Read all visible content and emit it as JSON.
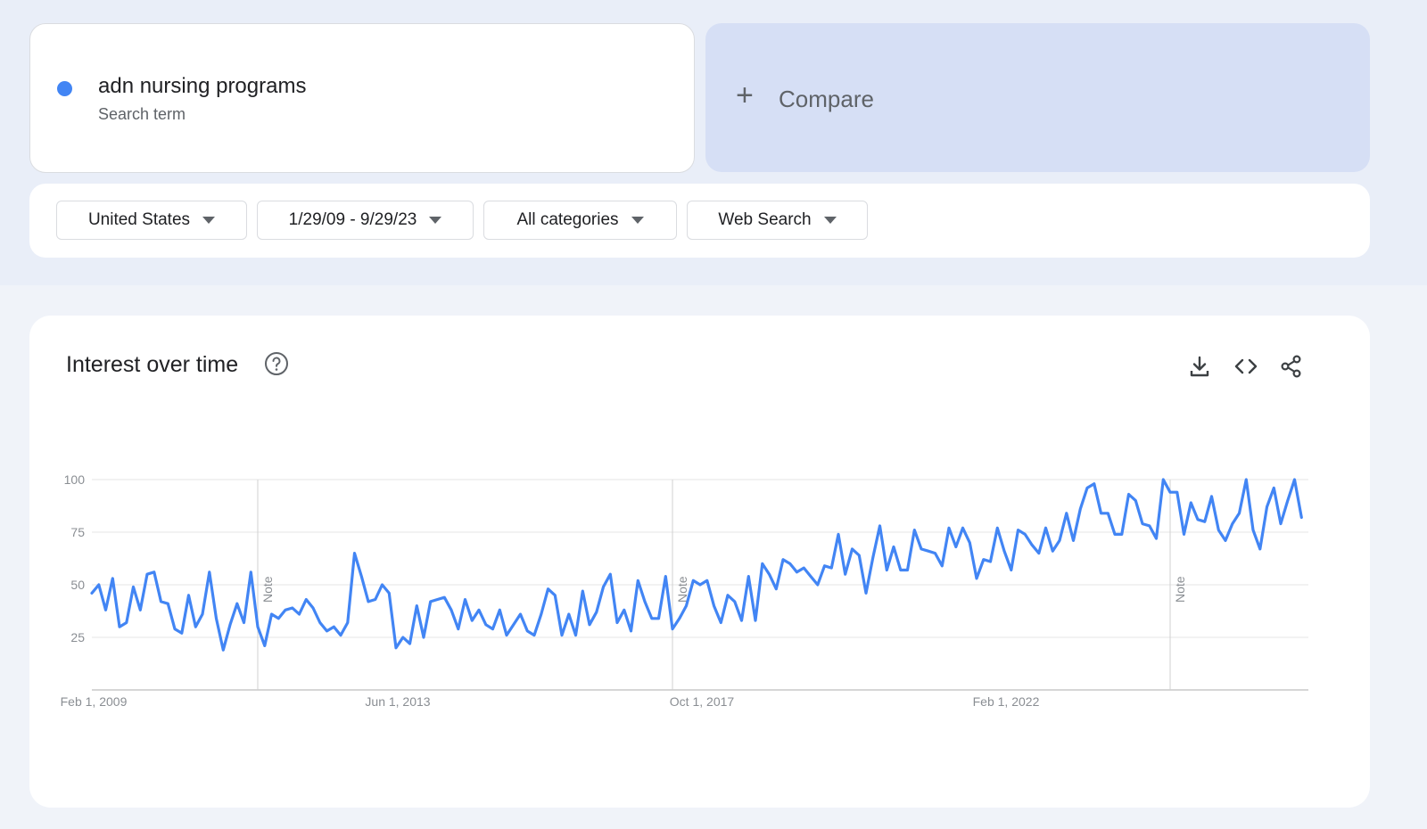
{
  "search_term": {
    "name": "adn nursing programs",
    "subtitle": "Search term",
    "color": "#4285f4"
  },
  "compare": {
    "plus": "+",
    "label": "Compare"
  },
  "filters": {
    "region": "United States",
    "date_range": "1/29/09 - 9/29/23",
    "category": "All categories",
    "search_type": "Web Search"
  },
  "panel": {
    "title": "Interest over time",
    "icons": [
      "help-icon",
      "download-icon",
      "embed-icon",
      "share-icon"
    ]
  },
  "chart_data": {
    "type": "line",
    "title": "Interest over time",
    "xlabel": "",
    "ylabel": "",
    "ylim": [
      0,
      100
    ],
    "y_ticks": [
      25,
      50,
      75,
      100
    ],
    "x_tick_labels": [
      "Feb 1, 2009",
      "Jun 1, 2013",
      "Oct 1, 2017",
      "Feb 1, 2022"
    ],
    "x_range": [
      "2009-01",
      "2023-09"
    ],
    "notes": [
      {
        "date": "2011-01",
        "label": "Note"
      },
      {
        "date": "2016-01",
        "label": "Note"
      },
      {
        "date": "2022-01",
        "label": "Note"
      }
    ],
    "series": [
      {
        "name": "adn nursing programs",
        "color": "#4285f4",
        "start": "2009-01",
        "frequency": "monthly",
        "values": [
          46,
          50,
          38,
          53,
          30,
          32,
          49,
          38,
          55,
          56,
          42,
          41,
          29,
          27,
          45,
          30,
          36,
          56,
          34,
          19,
          31,
          41,
          32,
          56,
          30,
          21,
          36,
          34,
          38,
          39,
          36,
          43,
          39,
          32,
          28,
          30,
          26,
          32,
          65,
          54,
          42,
          43,
          50,
          46,
          20,
          25,
          22,
          40,
          25,
          42,
          43,
          44,
          38,
          29,
          43,
          33,
          38,
          31,
          29,
          38,
          26,
          31,
          36,
          28,
          26,
          36,
          48,
          45,
          26,
          36,
          26,
          47,
          31,
          37,
          49,
          55,
          32,
          38,
          28,
          52,
          42,
          34,
          34,
          54,
          29,
          34,
          40,
          52,
          50,
          52,
          40,
          32,
          45,
          42,
          33,
          54,
          33,
          60,
          55,
          48,
          62,
          60,
          56,
          58,
          54,
          50,
          59,
          58,
          74,
          55,
          67,
          64,
          46,
          63,
          78,
          57,
          68,
          57,
          57,
          76,
          67,
          66,
          65,
          59,
          77,
          68,
          77,
          70,
          53,
          62,
          61,
          77,
          66,
          57,
          76,
          74,
          69,
          65,
          77,
          66,
          71,
          84,
          71,
          86,
          96,
          98,
          84,
          84,
          74,
          74,
          93,
          90,
          79,
          78,
          72,
          100,
          94,
          94,
          74,
          89,
          81,
          80,
          92,
          76,
          71,
          79,
          84,
          100,
          76,
          67,
          87,
          96,
          79,
          90,
          100,
          82
        ]
      }
    ]
  }
}
